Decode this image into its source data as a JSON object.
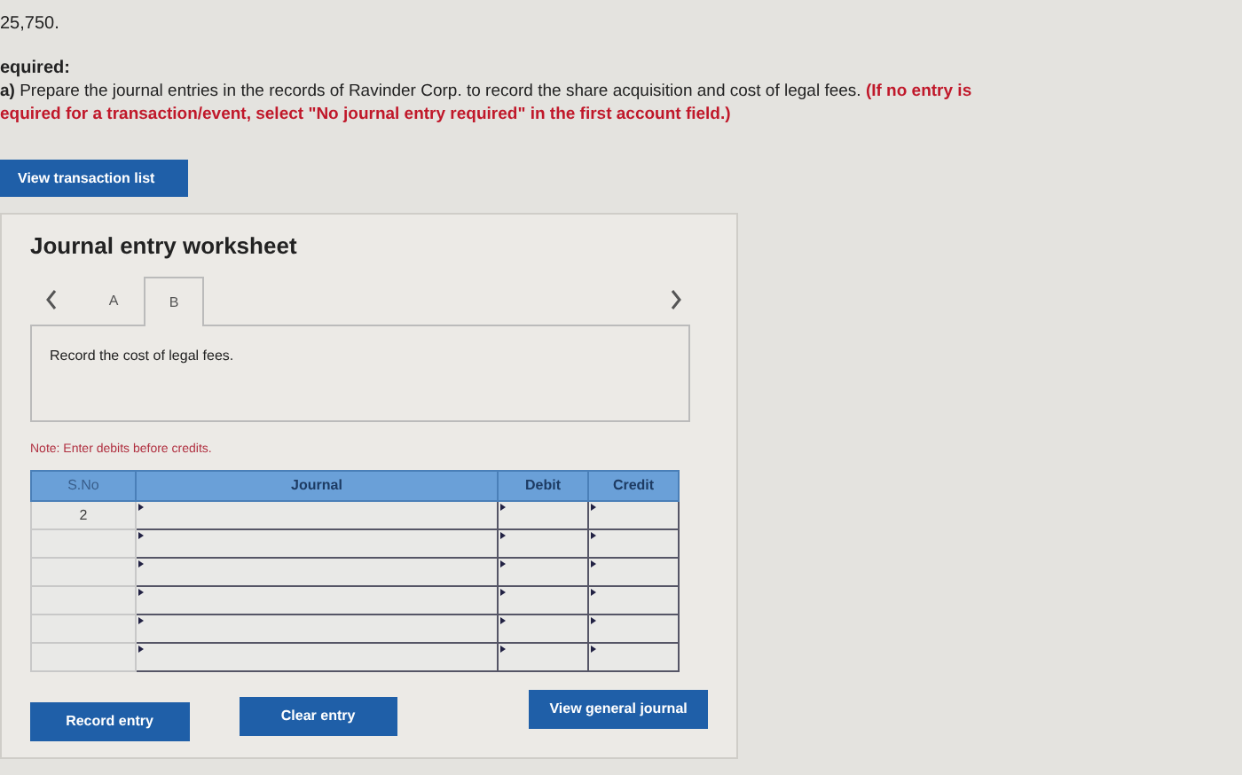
{
  "amount_line": "25,750.",
  "required": {
    "heading": "equired:",
    "part": "a)",
    "text": "Prepare the journal entries in the records of Ravinder Corp. to record the share acquisition and cost of legal fees.",
    "note": "(If no entry is",
    "note_cont": "equired for a transaction/event, select \"No journal entry required\" in the first account field.)"
  },
  "view_transactions_button": "View transaction list",
  "worksheet": {
    "title": "Journal entry worksheet",
    "tabs": [
      {
        "label": "A",
        "selected": false
      },
      {
        "label": "B",
        "selected": true
      }
    ],
    "instruction": "Record the cost of legal fees.",
    "note": "Note: Enter debits before credits.",
    "table": {
      "columns": [
        "S.No",
        "Journal",
        "Debit",
        "Credit"
      ],
      "rows": [
        {
          "s_no": "2"
        },
        {
          "s_no": ""
        },
        {
          "s_no": ""
        },
        {
          "s_no": ""
        },
        {
          "s_no": ""
        },
        {
          "s_no": ""
        }
      ]
    },
    "buttons": [
      "Record entry",
      "Clear entry",
      "View general journal"
    ]
  }
}
